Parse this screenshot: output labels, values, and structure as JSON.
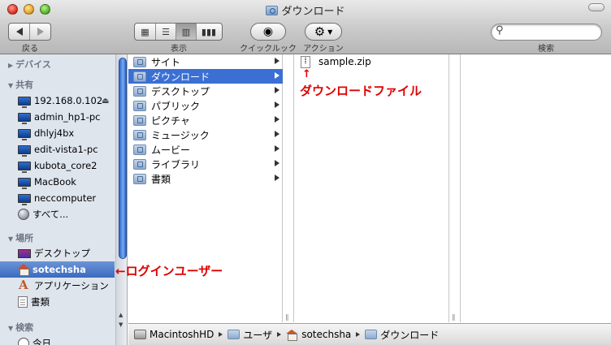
{
  "window": {
    "title": "ダウンロード"
  },
  "toolbar": {
    "back_label": "戻る",
    "view_label": "表示",
    "quicklook_label": "クイックルック",
    "action_label": "アクション",
    "search_label": "検索",
    "search_placeholder": ""
  },
  "sidebar": {
    "sections": [
      {
        "label": "デバイス",
        "state": "collapsed"
      },
      {
        "label": "共有",
        "state": "expanded"
      },
      {
        "label": "場所",
        "state": "expanded"
      },
      {
        "label": "検索",
        "state": "expanded"
      }
    ],
    "shared": [
      {
        "label": "192.168.0.102",
        "icon": "monitor-icon",
        "eject": "⏏"
      },
      {
        "label": "admin_hp1-pc",
        "icon": "monitor-icon"
      },
      {
        "label": "dhlyj4bx",
        "icon": "monitor-icon"
      },
      {
        "label": "edit-vista1-pc",
        "icon": "monitor-icon"
      },
      {
        "label": "kubota_core2",
        "icon": "monitor-icon"
      },
      {
        "label": "MacBook",
        "icon": "monitor-icon"
      },
      {
        "label": "neccomputer",
        "icon": "monitor-icon"
      },
      {
        "label": "すべて...",
        "icon": "globe-icon"
      }
    ],
    "places": [
      {
        "label": "デスクトップ",
        "icon": "desktop-icon"
      },
      {
        "label": "sotechsha",
        "icon": "home-icon",
        "selected": true
      },
      {
        "label": "アプリケーション",
        "icon": "applications-icon"
      },
      {
        "label": "書類",
        "icon": "document-icon"
      }
    ],
    "search": [
      {
        "label": "今日",
        "icon": "clock-icon"
      }
    ]
  },
  "column1": {
    "items": [
      {
        "label": "サイト"
      },
      {
        "label": "ダウンロード",
        "selected": true
      },
      {
        "label": "デスクトップ"
      },
      {
        "label": "パブリック"
      },
      {
        "label": "ピクチャ"
      },
      {
        "label": "ミュージック"
      },
      {
        "label": "ムービー"
      },
      {
        "label": "ライブラリ"
      },
      {
        "label": "書類"
      }
    ]
  },
  "column2": {
    "items": [
      {
        "label": "sample.zip"
      }
    ]
  },
  "annotations": {
    "download_file": "ダウンロードファイル",
    "login_user": "←ログインユーザー",
    "arrow_up": "↑"
  },
  "pathbar": {
    "items": [
      {
        "label": "MacintoshHD",
        "icon": "hard-drive-icon"
      },
      {
        "label": "ユーザ",
        "icon": "folder-icon"
      },
      {
        "label": "sotechsha",
        "icon": "home-icon"
      },
      {
        "label": "ダウンロード",
        "icon": "downloads-folder-icon"
      }
    ]
  },
  "colors": {
    "selection": "#3b6fd4",
    "sidebar_bg": "#dfe5ed",
    "annotation": "#e00000"
  }
}
